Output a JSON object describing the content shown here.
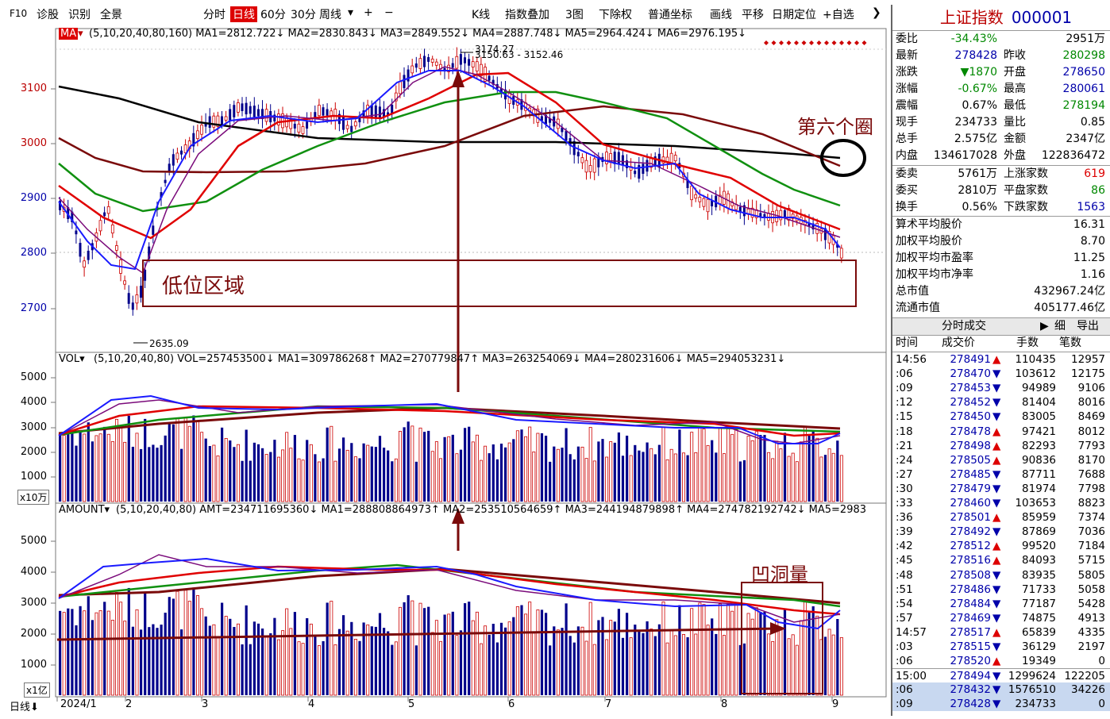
{
  "toolbar": {
    "left": [
      "F10",
      "诊股",
      "识别",
      "全景"
    ],
    "periods": [
      "分时",
      "日线",
      "60分",
      "30分",
      "周线"
    ],
    "selected_period": "日线",
    "right": [
      "K线",
      "指数叠加",
      "3图",
      "下除权",
      "普通坐标",
      "画线",
      "平移",
      "日期定位",
      "+自选"
    ]
  },
  "ma_line": "(5,10,20,40,80,160)  MA1=2812.722↓ MA2=2830.843↓ MA3=2849.552↓ MA4=2887.748↓ MA5=2964.424↓ MA6=2976.195↓",
  "vol_line": "(5,10,20,40,80)  VOL=257453500↓ MA1=309786268↑ MA2=270779847↑ MA3=263254069↓ MA4=280231606↓ MA5=294053231↓",
  "amt_line": "(5,10,20,40,80)  AMT=234711695360↓ MA1=288808864973↑ MA2=253510564659↑ MA3=244194879898↑ MA4=274782192742↓ MA5=2983",
  "price_labels": [
    "3100",
    "3000",
    "2900",
    "2800",
    "2700"
  ],
  "vol_labels": [
    "5000",
    "4000",
    "3000",
    "2000",
    "1000"
  ],
  "amt_labels": [
    "5000",
    "4000",
    "3000",
    "2000",
    "1000"
  ],
  "vol_unit": "x10万",
  "amt_unit": "x1亿",
  "annotations": {
    "high1": "3174.27",
    "high2": "3150.63 - 3152.46",
    "low": "2635.09",
    "low_zone": "低位区域",
    "sixth_circle": "第六个圈",
    "dent_volume": "凹洞量"
  },
  "x_axis": [
    "2024/1",
    "2",
    "3",
    "4",
    "5",
    "6",
    "7",
    "8",
    "9"
  ],
  "bottom_tab": "日线",
  "right_panel": {
    "name": "上证指数",
    "code": "000001",
    "stats": [
      {
        "l": "委比",
        "v": "-34.43%",
        "l2": "",
        "v2": "2951万"
      },
      {
        "l": "最新",
        "v": "278428",
        "l2": "昨收",
        "v2": "280298"
      },
      {
        "l": "涨跌",
        "v": "▼1870",
        "l2": "开盘",
        "v2": "278650"
      },
      {
        "l": "涨幅",
        "v": "-0.67%",
        "l2": "最高",
        "v2": "280061"
      },
      {
        "l": "震幅",
        "v": "0.67%",
        "l2": "最低",
        "v2": "278194"
      },
      {
        "l": "现手",
        "v": "234733",
        "l2": "量比",
        "v2": "0.85"
      },
      {
        "l": "总手",
        "v": "2.575亿",
        "l2": "金额",
        "v2": "2347亿"
      },
      {
        "l": "内盘",
        "v": "134617028",
        "l2": "外盘",
        "v2": "122836472"
      }
    ],
    "stats2": [
      {
        "l": "委卖",
        "v": "5761万",
        "l2": "上涨家数",
        "v2": "619"
      },
      {
        "l": "委买",
        "v": "2810万",
        "l2": "平盘家数",
        "v2": "86"
      },
      {
        "l": "换手",
        "v": "0.56%",
        "l2": "下跌家数",
        "v2": "1563"
      }
    ],
    "stats3": [
      {
        "l": "算术平均股价",
        "v": "16.31"
      },
      {
        "l": "加权平均股价",
        "v": "8.70"
      },
      {
        "l": "加权平均市盈率",
        "v": "11.25"
      },
      {
        "l": "加权平均市净率",
        "v": "1.16"
      },
      {
        "l": "总市值",
        "v": "432967.24亿"
      },
      {
        "l": "流通市值",
        "v": "405177.46亿"
      }
    ],
    "tabs": [
      "分时成交",
      "细",
      "导出"
    ],
    "tick_headers": [
      "时间",
      "成交价",
      "手数",
      "笔数"
    ],
    "ticks": [
      [
        "14:56",
        "278491",
        "▲",
        "110435",
        "12957"
      ],
      [
        ":06",
        "278470",
        "▼",
        "103612",
        "12175"
      ],
      [
        ":09",
        "278453",
        "▼",
        "94989",
        "9106"
      ],
      [
        ":12",
        "278452",
        "▼",
        "81404",
        "8016"
      ],
      [
        ":15",
        "278450",
        "▼",
        "83005",
        "8469"
      ],
      [
        ":18",
        "278478",
        "▲",
        "97421",
        "8012"
      ],
      [
        ":21",
        "278498",
        "▲",
        "82293",
        "7793"
      ],
      [
        ":24",
        "278505",
        "▲",
        "90836",
        "8170"
      ],
      [
        ":27",
        "278485",
        "▼",
        "87711",
        "7688"
      ],
      [
        ":30",
        "278479",
        "▼",
        "81974",
        "7798"
      ],
      [
        ":33",
        "278460",
        "▼",
        "103653",
        "8823"
      ],
      [
        ":36",
        "278501",
        "▲",
        "85959",
        "7374"
      ],
      [
        ":39",
        "278492",
        "▼",
        "87869",
        "7036"
      ],
      [
        ":42",
        "278512",
        "▲",
        "99520",
        "7184"
      ],
      [
        ":45",
        "278516",
        "▲",
        "84093",
        "5715"
      ],
      [
        ":48",
        "278508",
        "▼",
        "83935",
        "5805"
      ],
      [
        ":51",
        "278486",
        "▼",
        "71733",
        "5058"
      ],
      [
        ":54",
        "278484",
        "▼",
        "77187",
        "5428"
      ],
      [
        ":57",
        "278469",
        "▼",
        "74875",
        "4913"
      ],
      [
        "14:57",
        "278517",
        "▲",
        "65839",
        "4335"
      ],
      [
        ":03",
        "278515",
        "▼",
        "36129",
        "2197"
      ],
      [
        ":06",
        "278520",
        "▲",
        "19349",
        "0"
      ],
      [
        "15:00",
        "278494",
        "▼",
        "1299624",
        "122205"
      ],
      [
        ":06",
        "278432",
        "▼",
        "1576510",
        "34226"
      ],
      [
        ":09",
        "278428",
        "▼",
        "234733",
        "0"
      ]
    ]
  },
  "colors": {
    "up": "#cc0000",
    "down": "#00008b",
    "ma1": "#1a1aff",
    "ma2": "#7b0b7b",
    "ma3": "#e00000",
    "ma4": "#109010",
    "ma5": "#7a0a0a",
    "ma6": "#000000"
  }
}
